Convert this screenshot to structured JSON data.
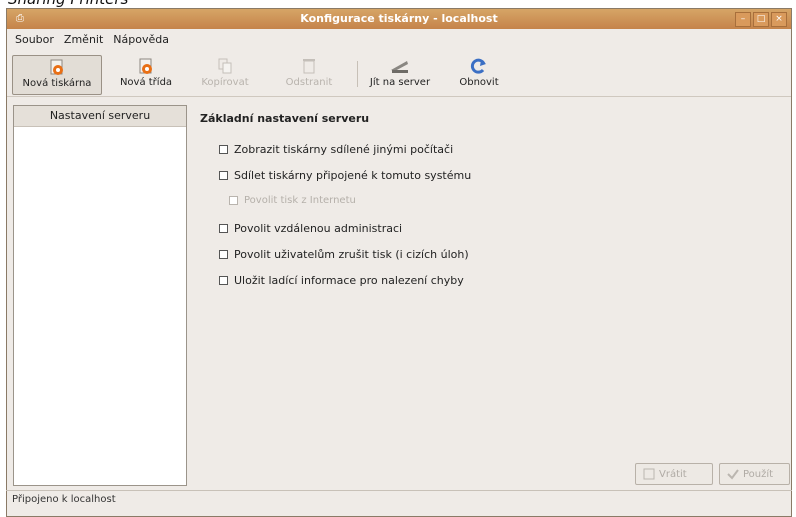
{
  "top_text": "Sharing Printers",
  "window": {
    "title": "Konfigurace tiskárny - localhost",
    "controls": [
      "–",
      "□",
      "×"
    ]
  },
  "menu": [
    "Soubor",
    "Změnit",
    "Nápověda"
  ],
  "toolbar": {
    "new_printer": "Nová tiskárna",
    "new_class": "Nová třída",
    "copy": "Kopírovat",
    "delete": "Odstranit",
    "goto_server": "Jít na server",
    "refresh": "Obnovit"
  },
  "sidebar": {
    "header": "Nastavení serveru"
  },
  "main": {
    "section_title": "Základní nastavení serveru",
    "options": [
      "Zobrazit tiskárny sdílené jinými počítači",
      "Sdílet tiskárny připojené k tomuto systému",
      "Povolit tisk z Internetu",
      "Povolit vzdálenou administraci",
      "Povolit uživatelům zrušit tisk (i cizích úloh)",
      "Uložit ladící informace pro nalezení chyby"
    ]
  },
  "buttons": {
    "revert": "Vrátit",
    "apply": "Použít"
  },
  "status": "Připojeno k localhost",
  "colors": {
    "titlebar": "#c98c52",
    "accent_orange": "#e86f16",
    "refresh_blue": "#3b6fc4"
  }
}
